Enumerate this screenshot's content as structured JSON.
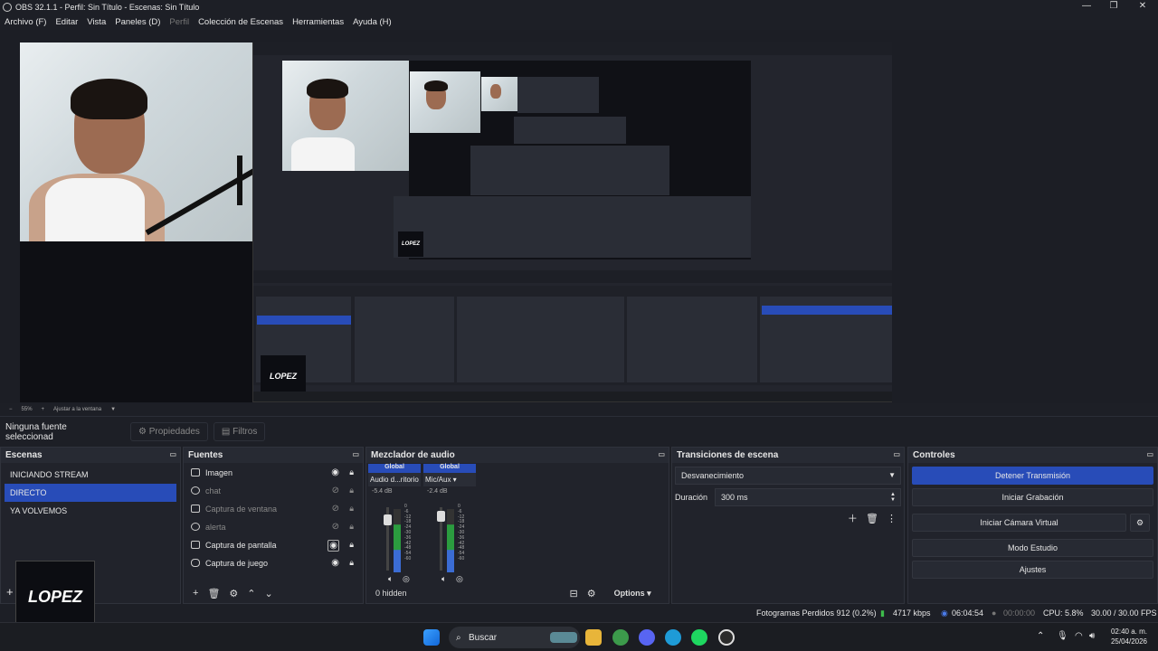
{
  "window": {
    "title": "OBS 32.1.1 - Perfil: Sin Título - Escenas: Sin Título"
  },
  "menu": [
    "Archivo (F)",
    "Editar",
    "Vista",
    "Paneles (D)",
    "Perfil",
    "Colección de Escenas",
    "Herramientas",
    "Ayuda (H)"
  ],
  "zoom": {
    "level": "55%",
    "fit_label": "Ajustar a la ventana"
  },
  "properties_bar": {
    "no_source": "Ninguna fuente seleccionad",
    "properties_label": "Propiedades",
    "filters_label": "Filtros"
  },
  "scenes": {
    "title": "Escenas",
    "items": [
      "INICIANDO STREAM",
      "DIRECTO",
      "YA VOLVEMOS"
    ],
    "selected": 1
  },
  "sources": {
    "title": "Fuentes",
    "items": [
      "Imagen",
      "chat",
      "Captura de ventana",
      "alerta",
      "Captura de pantalla",
      "Captura de juego"
    ]
  },
  "mixer": {
    "title": "Mezclador de audio",
    "global": "Global",
    "ch1_name": "Audio d...ritorio",
    "ch1_db": "-5.4 dB",
    "ch2_name": "Mic/Aux",
    "ch2_db": "-2.4 dB",
    "hidden": "0 hidden",
    "options": "Options",
    "scale": [
      "0",
      "-6",
      "-12",
      "-18",
      "-24",
      "-30",
      "-36",
      "-42",
      "-48",
      "-54",
      "-60"
    ]
  },
  "transitions": {
    "title": "Transiciones de escena",
    "selected": "Desvanecimiento",
    "duration_label": "Duración",
    "duration_value": "300 ms"
  },
  "controls": {
    "title": "Controles",
    "stop_stream": "Detener Transmisión",
    "start_record": "Iniciar Grabación",
    "start_vcam": "Iniciar Cámara Virtual",
    "studio_mode": "Modo Estudio",
    "settings": "Ajustes"
  },
  "status": {
    "dropped": "Fotogramas Perdidos 912 (0.2%)",
    "bitrate": "4717 kbps",
    "stream_time": "06:04:54",
    "rec_time": "00:00:00",
    "cpu": "CPU: 5.8%",
    "fps": "30.00 / 30.00 FPS"
  },
  "taskbar": {
    "search": "Buscar",
    "time": "02:40 a. m.",
    "date": "25/04/2026"
  },
  "logo_text": "LOPEZ"
}
